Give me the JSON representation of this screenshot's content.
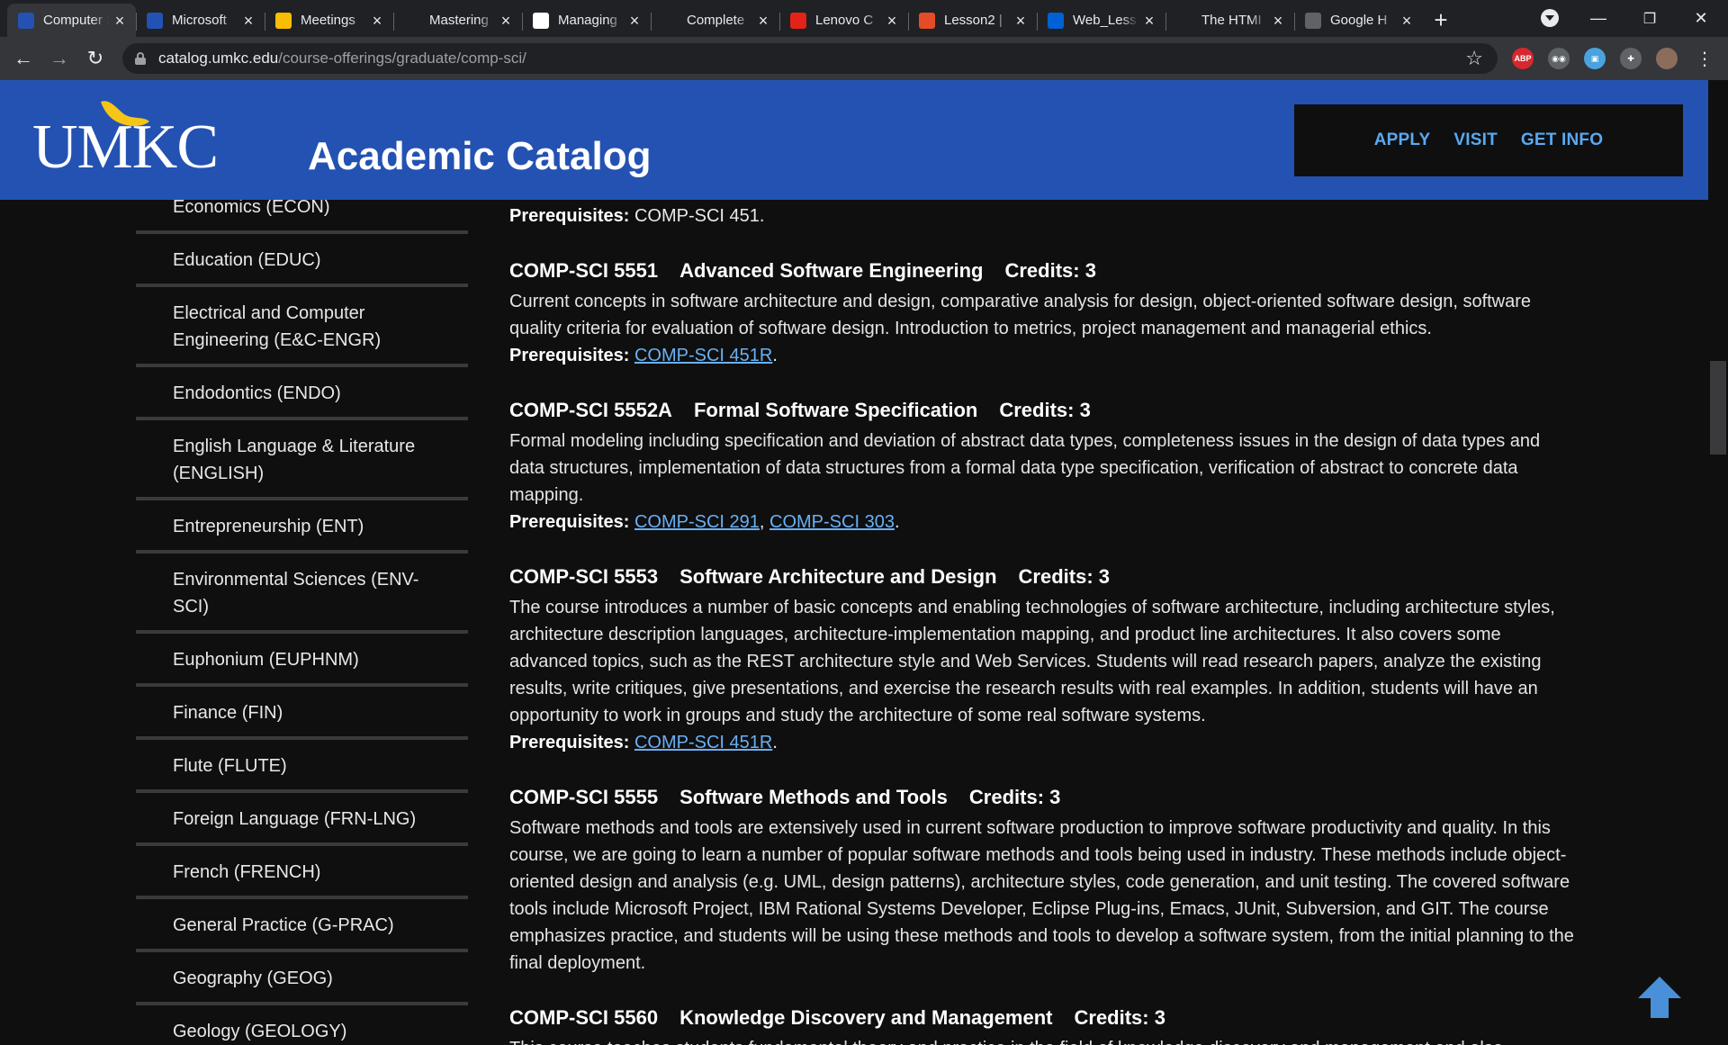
{
  "browser": {
    "tabs": [
      {
        "title": "Computer Science",
        "icon": "umkc-icon",
        "color": "#2452b3",
        "active": true
      },
      {
        "title": "Microsoft",
        "icon": "umkc-icon",
        "color": "#2452b3"
      },
      {
        "title": "Meetings",
        "icon": "drive-icon",
        "color": "#fbbc04"
      },
      {
        "title": "Mastering",
        "icon": "github-icon",
        "color": "#202124"
      },
      {
        "title": "Managing",
        "icon": "github-icon",
        "color": "#ffffff"
      },
      {
        "title": "Complete",
        "icon": "github-icon",
        "color": "#202124"
      },
      {
        "title": "Lenovo C",
        "icon": "lenovo-icon",
        "color": "#e2231a"
      },
      {
        "title": "Lesson2 |",
        "icon": "gear-icon",
        "color": "#e34c26"
      },
      {
        "title": "Web_Less",
        "icon": "box-icon",
        "color": "#0061d5"
      },
      {
        "title": "The HTMI",
        "icon": "a-icon",
        "color": "#202124"
      },
      {
        "title": "Google H",
        "icon": "globe-icon",
        "color": "#5f6368"
      }
    ],
    "url_host": "catalog.umkc.edu",
    "url_path": "/course-offerings/graduate/comp-sci/",
    "extensions": [
      {
        "name": "adblock-icon",
        "label": "ABP",
        "color": "#d7282f"
      },
      {
        "name": "spy-icon",
        "label": "◉◉",
        "color": "#5f6368"
      },
      {
        "name": "save-icon",
        "label": "▣",
        "color": "#4aa3df"
      },
      {
        "name": "puzzle-icon",
        "label": "✚",
        "color": "#5f6368"
      },
      {
        "name": "profile-avatar",
        "label": "",
        "color": "#8a6d5a"
      }
    ]
  },
  "header": {
    "logo_text": "UMKC",
    "title": "Academic Catalog",
    "cta": [
      "APPLY",
      "VISIT",
      "GET INFO"
    ]
  },
  "sidebar": {
    "items": [
      "Economics (ECON)",
      "Education (EDUC)",
      "Electrical and Computer Engineering (E&C-ENGR)",
      "Endodontics (ENDO)",
      "English Language & Literature (ENGLISH)",
      "Entrepreneurship (ENT)",
      "Environmental Sciences (ENV-SCI)",
      "Euphonium (EUPHNM)",
      "Finance (FIN)",
      "Flute (FLUTE)",
      "Foreign Language (FRN-LNG)",
      "French (FRENCH)",
      "General Practice (G-PRAC)",
      "Geography (GEOG)",
      "Geology (GEOLOGY)"
    ]
  },
  "content": {
    "top_prereq_label": "Prerequisites:",
    "top_prereq_text": "COMP-SCI 451.",
    "courses": [
      {
        "code": "COMP-SCI 5551",
        "name": "Advanced Software Engineering",
        "credits": "Credits: 3",
        "desc": "Current concepts in software architecture and design, comparative analysis for design, object-oriented software design, software quality criteria for evaluation of software design. Introduction to metrics, project management and managerial ethics.",
        "prereq_label": "Prerequisites:",
        "prereqs": [
          "COMP-SCI 451R"
        ]
      },
      {
        "code": "COMP-SCI 5552A",
        "name": "Formal Software Specification",
        "credits": "Credits: 3",
        "desc": "Formal modeling including specification and deviation of abstract data types, completeness issues in the design of data types and data structures, implementation of data structures from a formal data type specification, verification of abstract to concrete data mapping.",
        "prereq_label": "Prerequisites:",
        "prereqs": [
          "COMP-SCI 291",
          "COMP-SCI 303"
        ]
      },
      {
        "code": "COMP-SCI 5553",
        "name": "Software Architecture and Design",
        "credits": "Credits: 3",
        "desc": "The course introduces a number of basic concepts and enabling technologies of software architecture, including architecture styles, architecture description languages, architecture-implementation mapping, and product line architectures. It also covers some advanced topics, such as the REST architecture style and Web Services. Students will read research papers, analyze the existing results, write critiques, give presentations, and exercise the research results with real examples. In addition, students will have an opportunity to work in groups and study the architecture of some real software systems.",
        "prereq_label": "Prerequisites:",
        "prereqs": [
          "COMP-SCI 451R"
        ]
      },
      {
        "code": "COMP-SCI 5555",
        "name": "Software Methods and Tools",
        "credits": "Credits: 3",
        "desc": "Software methods and tools are extensively used in current software production to improve software productivity and quality. In this course, we are going to learn a number of popular software methods and tools being used in industry. These methods include object-oriented design and analysis (e.g. UML, design patterns), architecture styles, code generation, and unit testing. The covered software tools include Microsoft Project, IBM Rational Systems Developer, Eclipse Plug-ins, Emacs, JUnit, Subversion, and GIT. The course emphasizes practice, and students will be using these methods and tools to develop a software system, from the initial planning to the final deployment.",
        "prereq_label": "",
        "prereqs": []
      },
      {
        "code": "COMP-SCI 5560",
        "name": "Knowledge Discovery and Management",
        "credits": "Credits: 3",
        "desc": "This course teaches students fundamental theory and practice in the field of knowledge discovery and management and also provides",
        "prereq_label": "",
        "prereqs": []
      }
    ]
  },
  "colors": {
    "header_bg": "#2452b3",
    "link": "#6ab0f3",
    "cta": "#5aa9f0",
    "back_to_top": "#4a90d9"
  }
}
